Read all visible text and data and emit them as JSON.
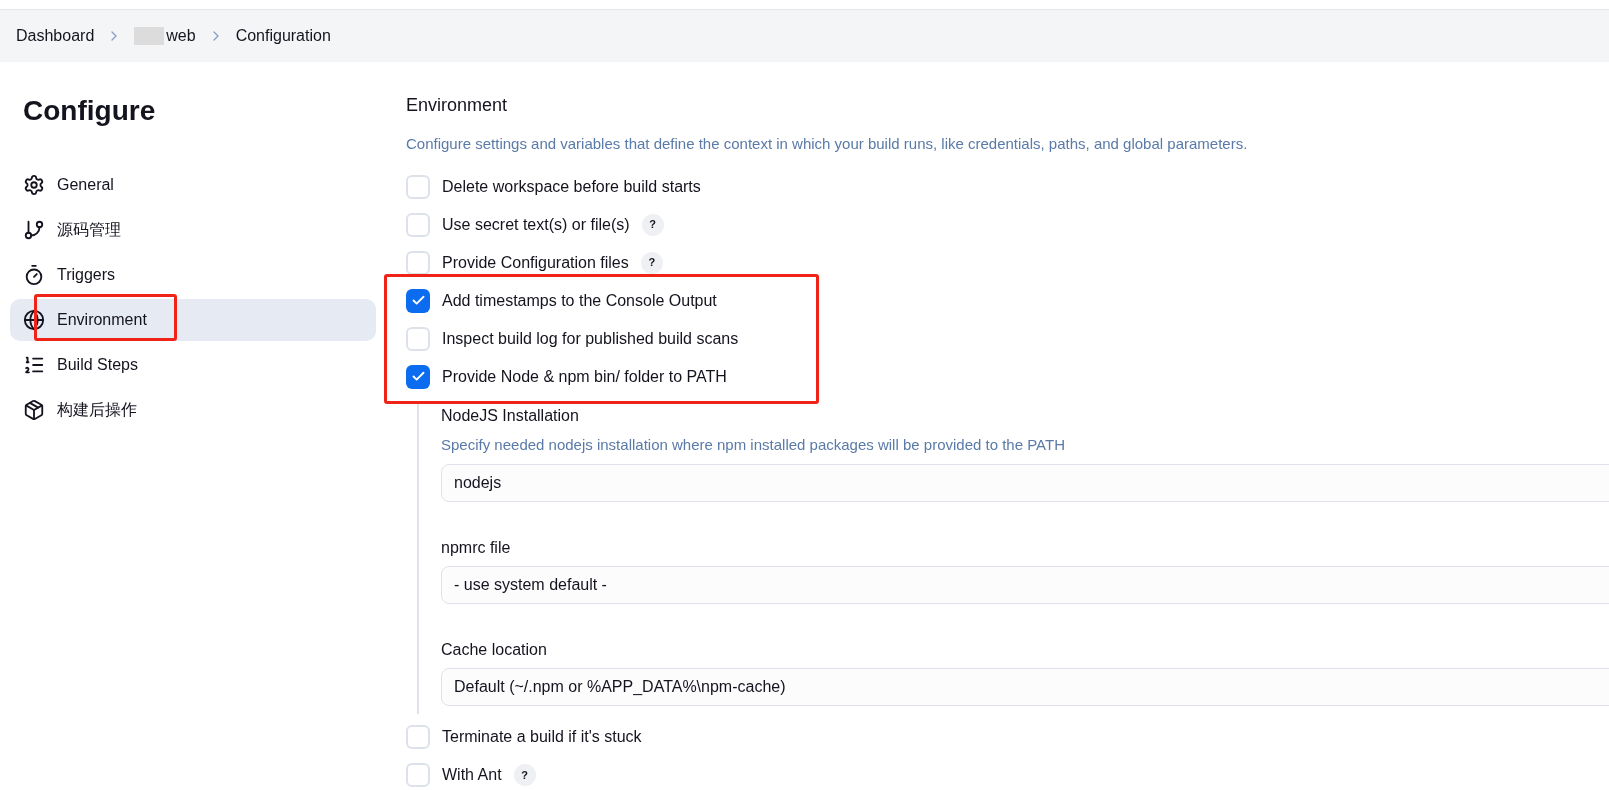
{
  "breadcrumb": [
    "Dashboard",
    "web",
    "Configuration"
  ],
  "sidebar": {
    "title": "Configure",
    "items": [
      {
        "label": "General",
        "selected": false
      },
      {
        "label": "源码管理",
        "selected": false
      },
      {
        "label": "Triggers",
        "selected": false
      },
      {
        "label": "Environment",
        "selected": true
      },
      {
        "label": "Build Steps",
        "selected": false
      },
      {
        "label": "构建后操作",
        "selected": false
      }
    ]
  },
  "section": {
    "title": "Environment",
    "description": "Configure settings and variables that define the context in which your build runs, like credentials, paths, and global parameters.",
    "options": [
      {
        "label": "Delete workspace before build starts",
        "checked": false
      },
      {
        "label": "Use secret text(s) or file(s)",
        "checked": false,
        "help": "?"
      },
      {
        "label": "Provide Configuration files",
        "checked": false,
        "help": "?"
      },
      {
        "label": "Add timestamps to the Console Output",
        "checked": true
      },
      {
        "label": "Inspect build log for published build scans",
        "checked": false
      },
      {
        "label": "Provide Node & npm bin/ folder to PATH",
        "checked": true,
        "fields": [
          {
            "label": "NodeJS Installation",
            "hint": "Specify needed nodejs installation where npm installed packages will be provided to the PATH",
            "value": "nodejs"
          },
          {
            "label": "npmrc file",
            "value": "- use system default -"
          },
          {
            "label": "Cache location",
            "value": "Default (~/.npm or %APP_DATA%\\npm-cache)"
          }
        ]
      },
      {
        "label": "Terminate a build if it's stuck",
        "checked": false
      },
      {
        "label": "With Ant",
        "checked": false,
        "help": "?"
      }
    ]
  }
}
